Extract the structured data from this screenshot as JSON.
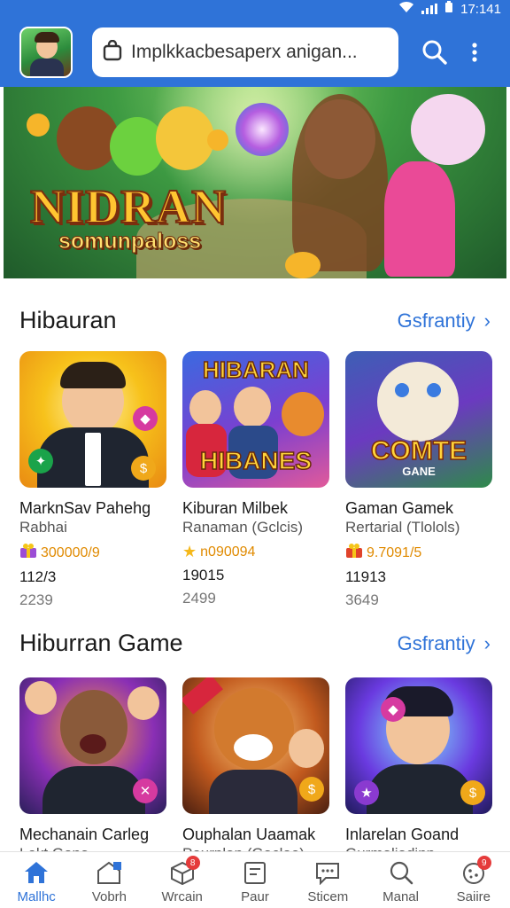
{
  "status_bar": {
    "time": "17:141"
  },
  "header": {
    "search_placeholder": "Implkkacbesaperx anigan..."
  },
  "banner": {
    "title": "NIDRAN",
    "subtitle": "somunpaloss"
  },
  "sections": [
    {
      "title": "Hibauran",
      "more_label": "Gsfrantiy",
      "cards": [
        {
          "title": "MarknSav Pahehg",
          "subtitle": "Rabhai",
          "score": "300000/9",
          "meta1": "112/3",
          "meta2": "2239"
        },
        {
          "title": "Kiburan Milbek",
          "subtitle": "Ranaman (Gclcis)",
          "score": "n090094",
          "meta1": "19015",
          "meta2": "2499"
        },
        {
          "title": "Gaman Gamek",
          "subtitle": "Rertarial (Tlolols)",
          "score": "9.7091/5",
          "meta1": "11913",
          "meta2": "3649"
        }
      ],
      "thumb_texts": [
        "",
        "HIBARAN",
        "COMTE"
      ],
      "thumb_texts2": [
        "",
        "HIBANES",
        "GANE"
      ]
    },
    {
      "title": "Hiburran Game",
      "more_label": "Gsfrantiy",
      "cards": [
        {
          "title": "Mechanain Carleg",
          "subtitle": "Lekt Gona"
        },
        {
          "title": "Ouphalan Uaamak",
          "subtitle": "Pourplan (Gacloe)"
        },
        {
          "title": "Inlarelan Goand",
          "subtitle": "Gurmaliadinn"
        }
      ]
    }
  ],
  "bottom_nav": [
    {
      "label": "Mallhc",
      "icon": "home-icon",
      "active": true
    },
    {
      "label": "Vobrh",
      "icon": "dashboard-icon"
    },
    {
      "label": "Wrcain",
      "icon": "box-icon",
      "badge": "8"
    },
    {
      "label": "Paur",
      "icon": "document-icon"
    },
    {
      "label": "Sticem",
      "icon": "chat-icon"
    },
    {
      "label": "Manal",
      "icon": "search-icon"
    },
    {
      "label": "Saiire",
      "icon": "cookie-icon",
      "badge": "9"
    }
  ],
  "colors": {
    "brand": "#2f73d8",
    "score": "#e08a00",
    "badge": "#e53b3b"
  }
}
